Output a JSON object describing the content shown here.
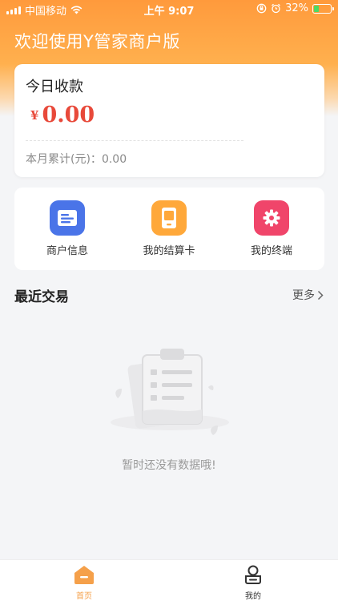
{
  "status_bar": {
    "carrier": "中国移动",
    "time": "上午 9:07",
    "battery": "32%",
    "battery_level": 0.32
  },
  "header": {
    "title": "欢迎使用Y管家商户版"
  },
  "today": {
    "title": "今日收款",
    "currency": "¥",
    "amount": "0.00",
    "month_label": "本月累计(元)：",
    "month_value": "0.00"
  },
  "quick_menu": [
    {
      "label": "商户信息",
      "icon": "merchant-info-icon",
      "color": "#4a74e8"
    },
    {
      "label": "我的结算卡",
      "icon": "settlement-card-icon",
      "color": "#ffa83a"
    },
    {
      "label": "我的终端",
      "icon": "terminal-gear-icon",
      "color": "#f0456a"
    }
  ],
  "recent": {
    "title": "最近交易",
    "more": "更多",
    "empty_text": "暂时还没有数据哦!"
  },
  "tab_bar": {
    "active_color": "#f5a04a",
    "items": [
      {
        "label": "首页",
        "icon": "home-icon",
        "active": true
      },
      {
        "label": "我的",
        "icon": "profile-icon",
        "active": false
      }
    ]
  }
}
